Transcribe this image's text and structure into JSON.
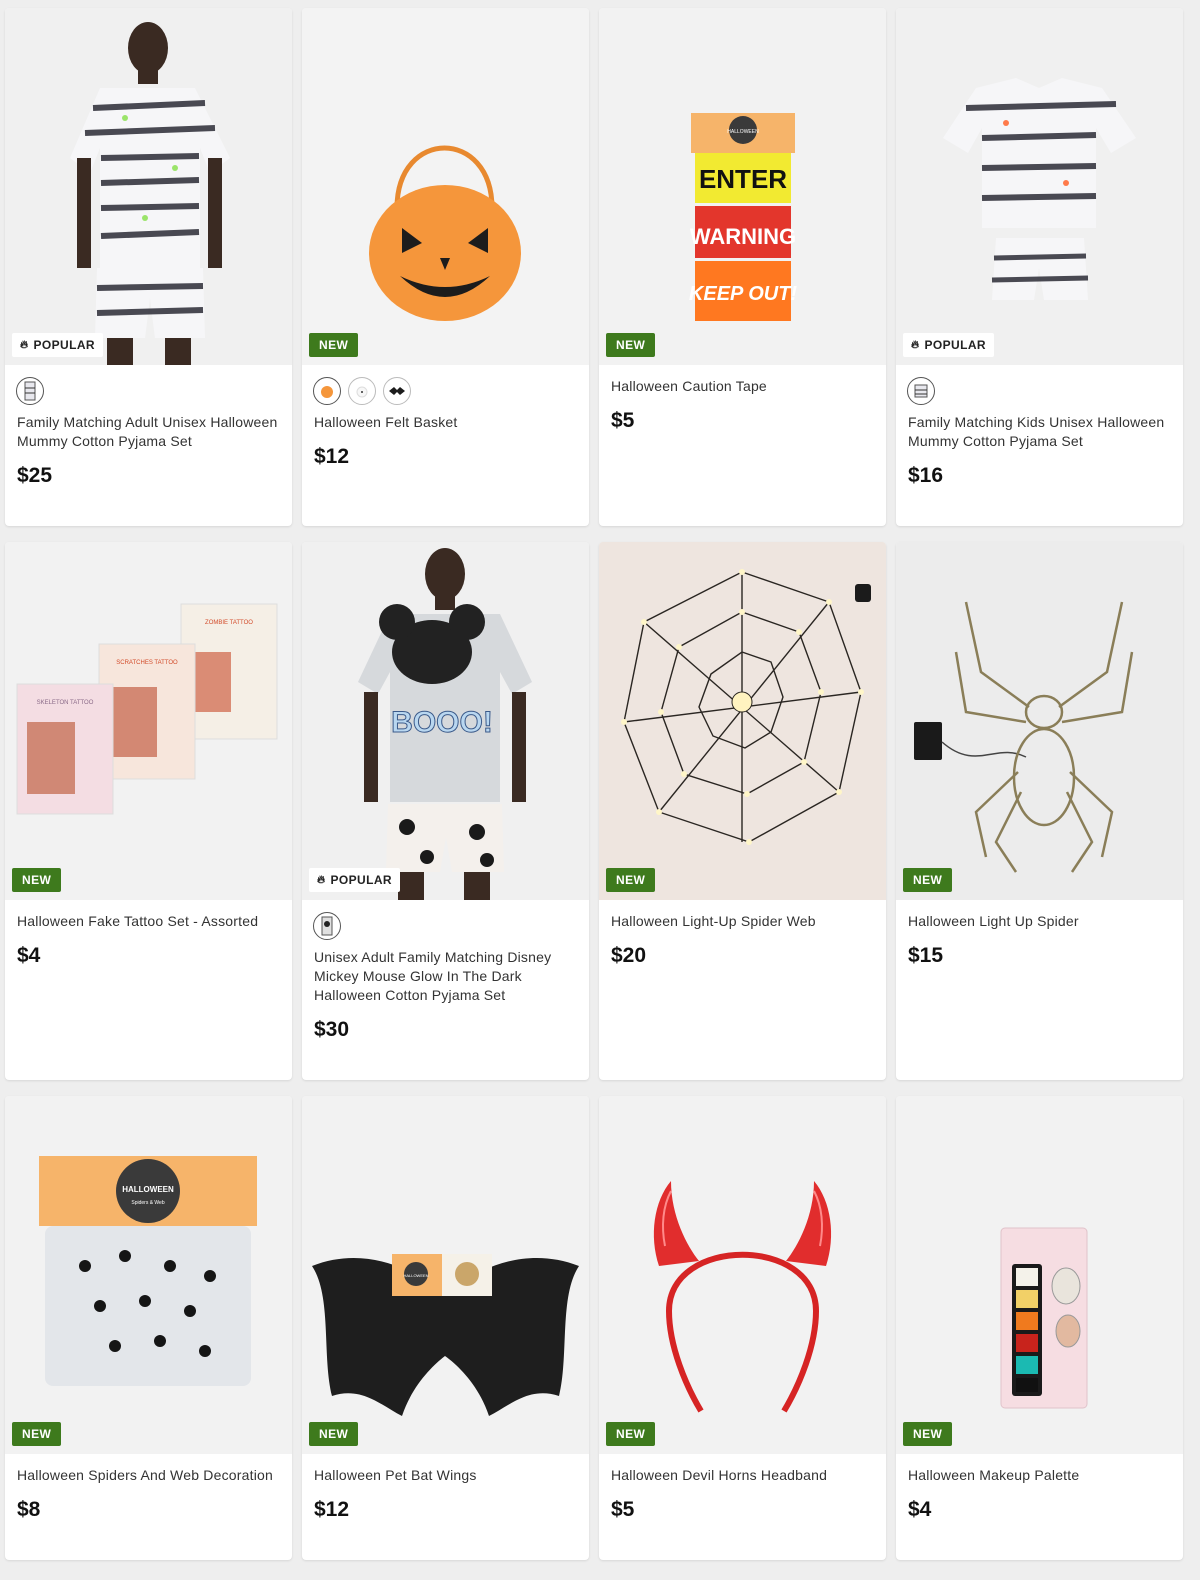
{
  "products": [
    {
      "title": "Family Matching Adult Unisex Halloween Mummy Cotton Pyjama Set",
      "price": "$25",
      "badge": "POPULAR",
      "image": "man-mummy-pyjama",
      "swatches": [
        "mummy-print"
      ]
    },
    {
      "title": "Halloween Felt Basket",
      "price": "$12",
      "badge": "NEW",
      "image": "pumpkin-basket",
      "swatches": [
        "pumpkin",
        "ghost",
        "bat"
      ]
    },
    {
      "title": "Halloween Caution Tape",
      "price": "$5",
      "badge": "NEW",
      "image": "caution-tape",
      "swatches": []
    },
    {
      "title": "Family Matching Kids Unisex Halloween Mummy Cotton Pyjama Set",
      "price": "$16",
      "badge": "POPULAR",
      "image": "kids-mummy-pyjama",
      "swatches": [
        "mummy-print"
      ]
    },
    {
      "title": "Halloween Fake Tattoo Set - Assorted",
      "price": "$4",
      "badge": "NEW",
      "image": "tattoo-packs",
      "swatches": []
    },
    {
      "title": "Unisex Adult Family Matching Disney Mickey Mouse Glow In The Dark Halloween Cotton Pyjama Set",
      "price": "$30",
      "badge": "POPULAR",
      "image": "man-mickey-pyjama",
      "swatches": [
        "mickey-print"
      ]
    },
    {
      "title": "Halloween Light-Up Spider Web",
      "price": "$20",
      "badge": "NEW",
      "image": "light-spider-web",
      "swatches": []
    },
    {
      "title": "Halloween Light Up Spider",
      "price": "$15",
      "badge": "NEW",
      "image": "light-spider",
      "swatches": []
    },
    {
      "title": "Halloween Spiders And Web Decoration",
      "price": "$8",
      "badge": "NEW",
      "image": "spiders-web-pack",
      "swatches": []
    },
    {
      "title": "Halloween Pet Bat Wings",
      "price": "$12",
      "badge": "NEW",
      "image": "bat-wings",
      "swatches": []
    },
    {
      "title": "Halloween Devil Horns Headband",
      "price": "$5",
      "badge": "NEW",
      "image": "devil-horns",
      "swatches": []
    },
    {
      "title": "Halloween Makeup Palette",
      "price": "$4",
      "badge": "NEW",
      "image": "makeup-palette",
      "swatches": []
    }
  ],
  "package_texts": {
    "caution_tape": [
      "HALLOWEEN",
      "ENTER",
      "WARNING",
      "KEEP OUT!"
    ],
    "tattoo_packs": [
      "SKELETON TATTOO",
      "SCRATCHES TATTOO",
      "ZOMBIE TATTOO"
    ],
    "spiders_pack": [
      "HALLOWEEN",
      "Spiders & Web"
    ],
    "bat_wings_tag": [
      "HALLOWEEN"
    ],
    "mickey_shirt": [
      "BOOO!"
    ]
  },
  "colors": {
    "new_badge": "#3e7a1d",
    "popular_badge": "#ffffff",
    "price": "#111111",
    "page_bg": "#eeeeee"
  },
  "icons": {
    "popular": "flame-icon"
  }
}
